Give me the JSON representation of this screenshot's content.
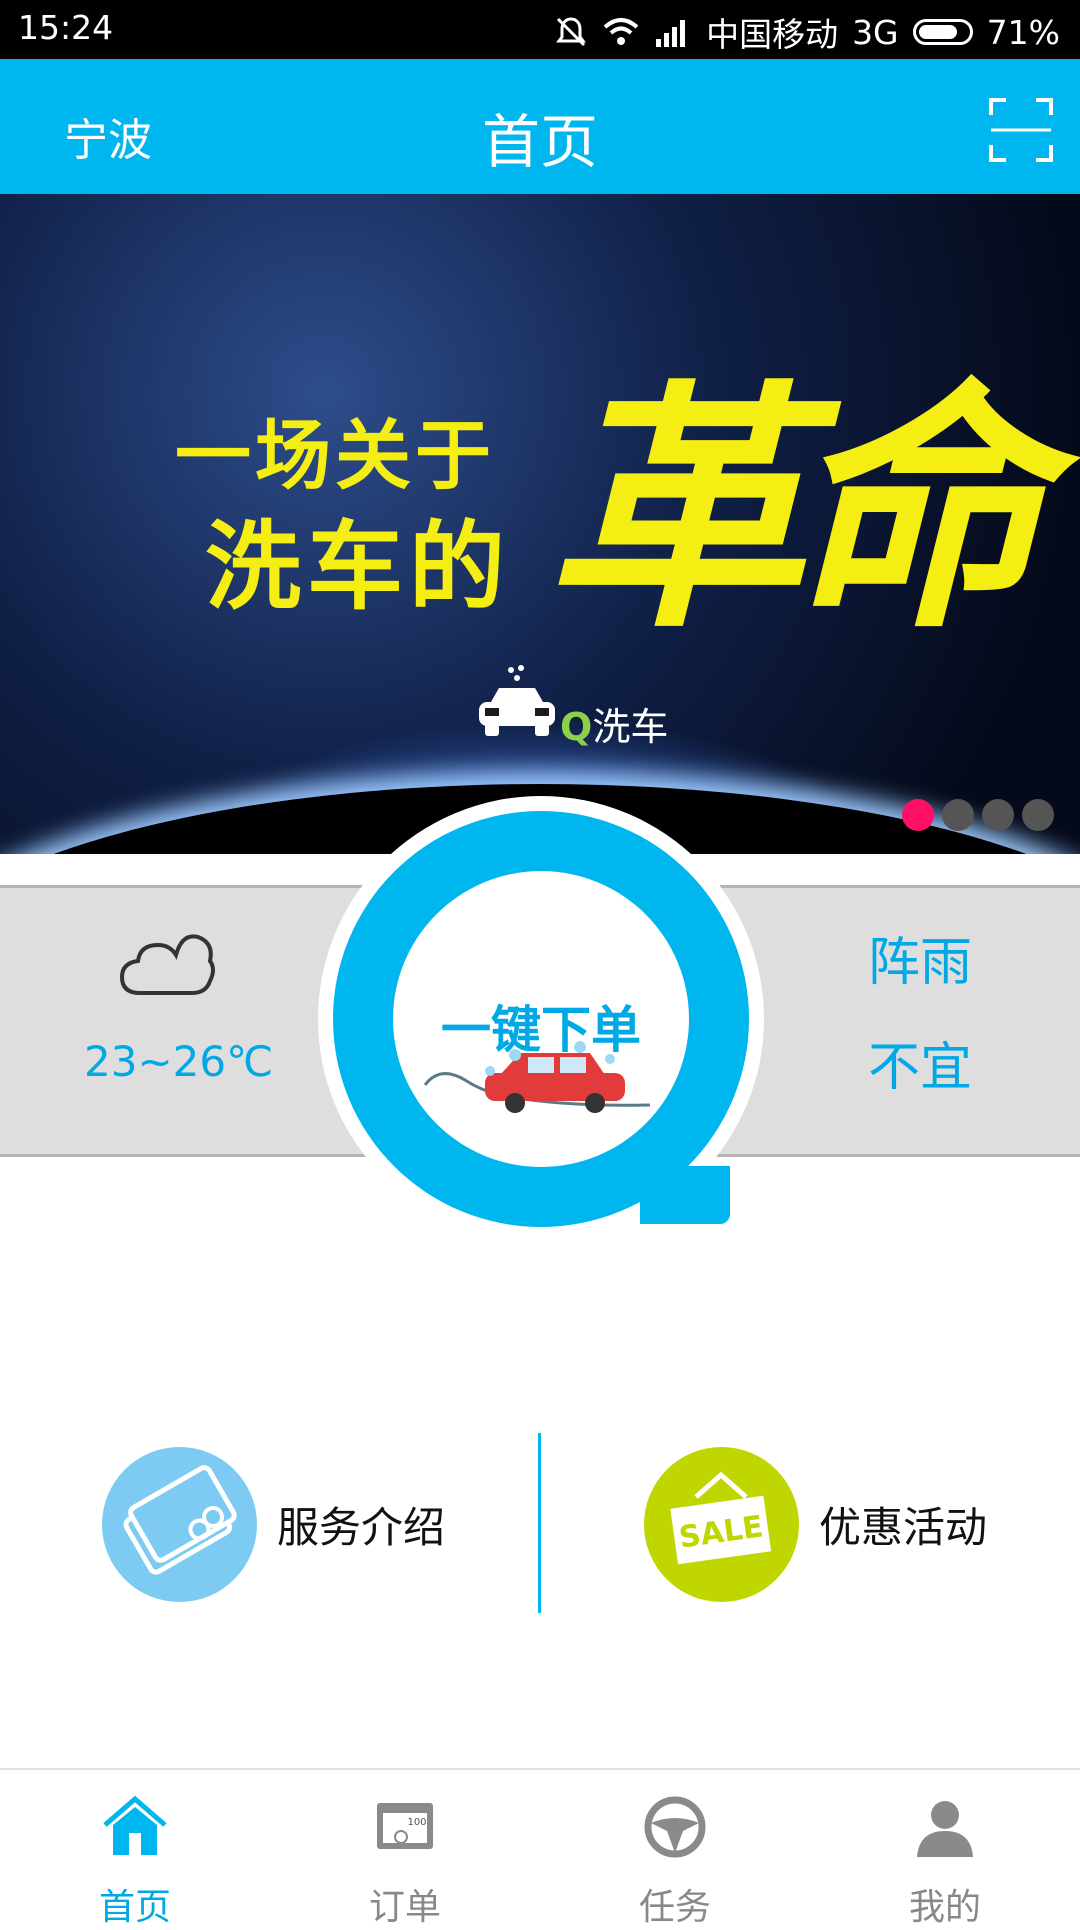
{
  "status_bar": {
    "time": "15:24",
    "carrier": "中国移动",
    "network": "3G",
    "battery": "71%"
  },
  "header": {
    "city": "宁波",
    "title": "首页",
    "scan_icon": "scan-icon"
  },
  "banner": {
    "line1": "一场关于",
    "line2": "洗车的",
    "big_text": "革命",
    "brand_q": "Q",
    "brand_text": "洗车",
    "slide_count": 4,
    "active_slide": 1,
    "active_dot_color": "#ff1066"
  },
  "weather": {
    "icon": "cloud-icon",
    "temperature": "23~26℃",
    "condition": "阵雨",
    "wash_advice": "不宜"
  },
  "order_button": {
    "label": "一键下单"
  },
  "features": [
    {
      "label": "服务介绍",
      "icon": "coupon-icon",
      "color": "#7dcaf2"
    },
    {
      "label": "优惠活动",
      "icon": "sale-tag-icon",
      "color": "#bfd600"
    }
  ],
  "sale_tag_text": "SALE",
  "bottom_nav": [
    {
      "label": "首页",
      "icon": "home-icon",
      "active": true
    },
    {
      "label": "订单",
      "icon": "order-icon",
      "active": false
    },
    {
      "label": "任务",
      "icon": "steering-wheel-icon",
      "active": false
    },
    {
      "label": "我的",
      "icon": "user-icon",
      "active": false
    }
  ],
  "colors": {
    "accent": "#00b6ee",
    "text_accent": "#00a9e6",
    "banner_text": "#f5ee12"
  }
}
